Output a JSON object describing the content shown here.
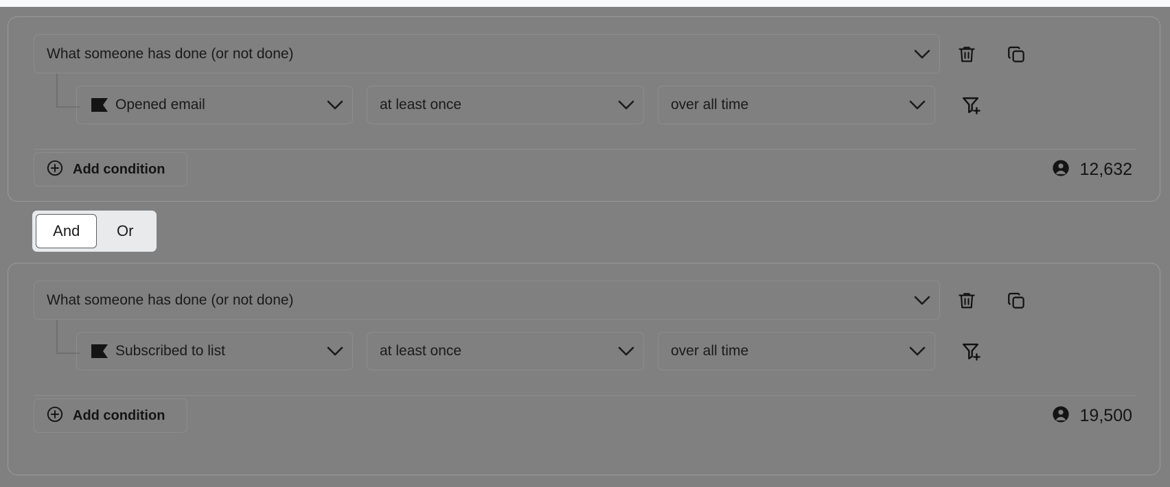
{
  "groups": [
    {
      "trigger_label": "What someone has done (or not done)",
      "delete_icon": "trash-icon",
      "duplicate_icon": "copy-icon",
      "condition": {
        "metric_icon": "flag-icon",
        "metric_label": "Opened email",
        "frequency_label": "at least once",
        "timeframe_label": "over all time",
        "filter_icon": "filter-plus-icon"
      },
      "add_condition_label": "Add condition",
      "add_condition_icon": "plus-circle-icon",
      "count_icon": "person-icon",
      "count_value": "12,632"
    },
    {
      "trigger_label": "What someone has done (or not done)",
      "delete_icon": "trash-icon",
      "duplicate_icon": "copy-icon",
      "condition": {
        "metric_icon": "flag-icon",
        "metric_label": "Subscribed to list",
        "frequency_label": "at least once",
        "timeframe_label": "over all time",
        "filter_icon": "filter-plus-icon"
      },
      "add_condition_label": "Add condition",
      "add_condition_icon": "plus-circle-icon",
      "count_icon": "person-icon",
      "count_value": "19,500"
    }
  ],
  "logic_toggle": {
    "and_label": "And",
    "or_label": "Or",
    "selected": "And"
  },
  "colors": {
    "overlay": "#808080",
    "page_background": "#f8f9fb",
    "card_border": "#9b9b9b",
    "control_border": "#8d8d8d",
    "text": "#1a1a1a",
    "toggle_track": "#e8eaec",
    "toggle_selected": "#ffffff"
  }
}
